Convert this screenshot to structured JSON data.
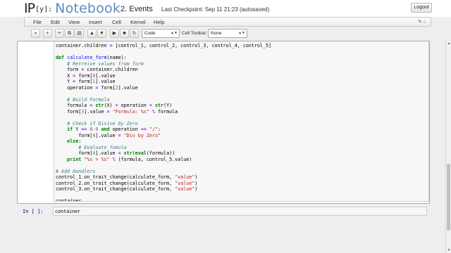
{
  "header": {
    "logo_ip": "IP",
    "logo_y": "[y]:",
    "logo_notebook": "Notebook",
    "notebook_title": "2. Events",
    "checkpoint": "Last Checkpoint: Sep 11 21:23 (autosaved)",
    "logout_label": "Logout"
  },
  "menubar": {
    "items": [
      "File",
      "Edit",
      "View",
      "Insert",
      "Cell",
      "Kernel",
      "Help"
    ],
    "kernel_indicator_icon": "edit-pencil-icon, kernel-idle-circle-icon"
  },
  "toolbar": {
    "buttons": [
      {
        "icon": "save-icon",
        "glyph": "▪"
      },
      {
        "icon": "insert-cell-icon",
        "glyph": "+"
      },
      {
        "icon": "cut-icon",
        "glyph": "✂"
      },
      {
        "icon": "copy-icon",
        "glyph": "⧉"
      },
      {
        "icon": "paste-icon",
        "glyph": "▤"
      },
      {
        "icon": "move-up-icon",
        "glyph": "▲"
      },
      {
        "icon": "move-down-icon",
        "glyph": "▼"
      },
      {
        "icon": "run-icon",
        "glyph": "▶"
      },
      {
        "icon": "stop-icon",
        "glyph": "■"
      },
      {
        "icon": "restart-icon",
        "glyph": "↻"
      }
    ],
    "cell_type_value": "Code",
    "cell_toolbar_label": "Cell Toolbar:",
    "cell_toolbar_value": "None"
  },
  "cells": {
    "cell1_lines": [
      "container.children = [control_1, control_2, control_3, control_4, control_5]",
      "",
      "def calculate_form(name):",
      "    # Retreive values from form",
      "    form = container.children",
      "    X = form[0].value",
      "    Y = form[1].value",
      "    operation = form[2].value",
      "",
      "    # Build Formula",
      "    formula = str(X) + operation + str(Y)",
      "    form[3].value = \"Formula: %s\" % formula",
      "",
      "    # Check if Divive by Zero",
      "    if Y == 0.0 and operation == \"/\":",
      "        form[4].value = \"Div by Zero\"",
      "    else:",
      "        # Evaluate fumula",
      "        form[4].value = str(eval(formula))",
      "    print \"%s = %s\" % (formula, control_5.value)",
      "",
      "# Add Handlers",
      "control_1.on_trait_change(calculate_form, \"value\")",
      "control_2.on_trait_change(calculate_form, \"value\")",
      "control_3.on_trait_change(calculate_form, \"value\")",
      "",
      "container"
    ],
    "cell2_prompt": "In [ ]:",
    "cell2_code": "container"
  },
  "colors": {
    "notebook_blue": "#5a8cc0",
    "keyword_green": "#008000",
    "comment_teal": "#408080",
    "string_red": "#ba2121",
    "prompt_navy": "#000080"
  }
}
